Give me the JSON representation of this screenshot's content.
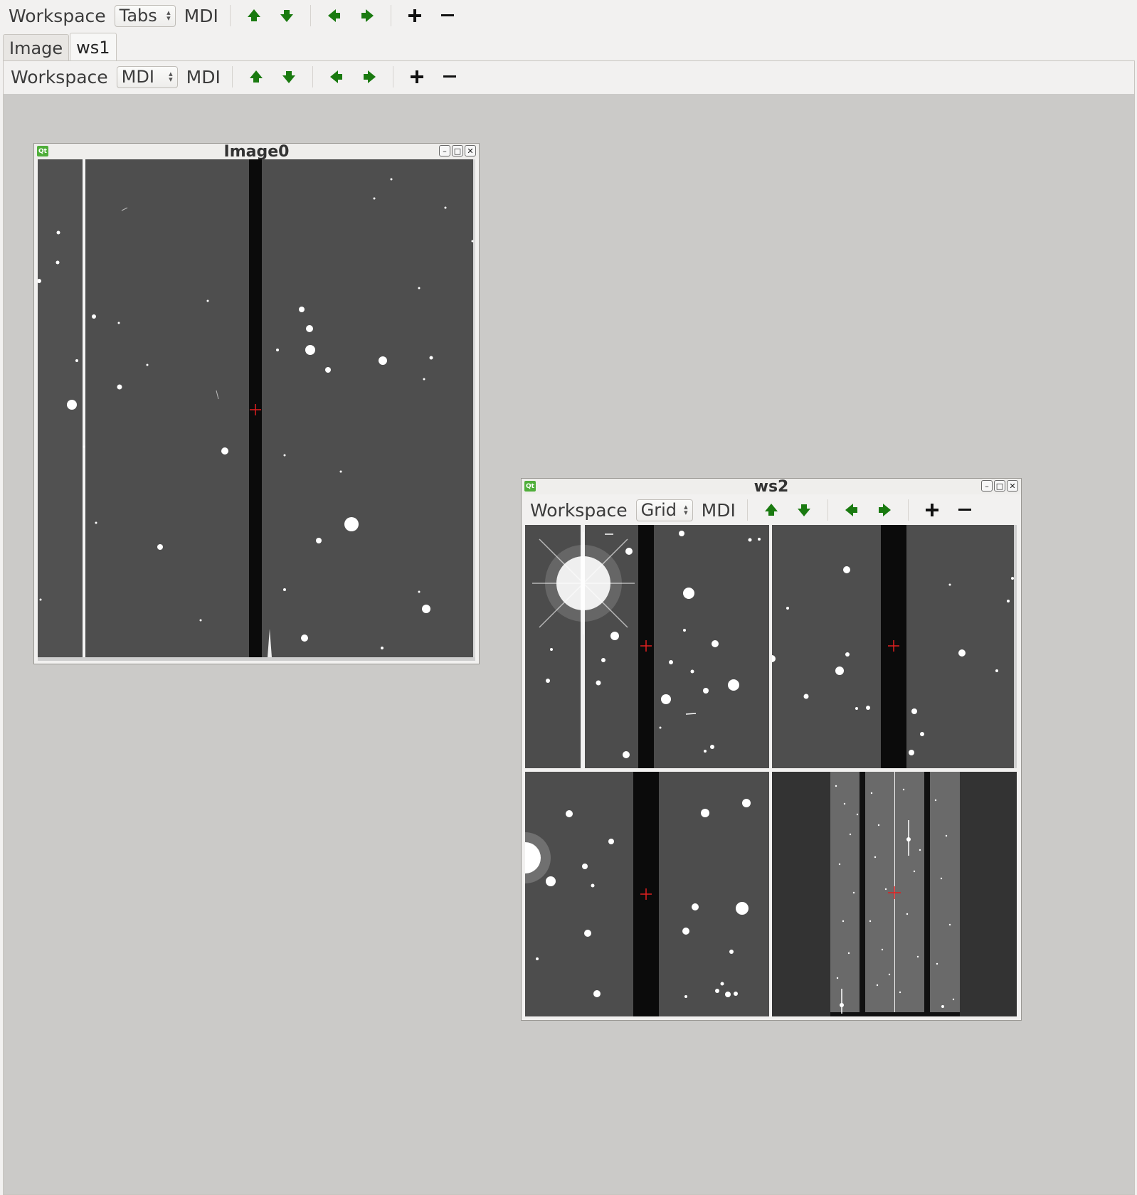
{
  "top_toolbar": {
    "workspace_label": "Workspace",
    "mode_combo_value": "Tabs",
    "mdi_label": "MDI"
  },
  "tabs": [
    {
      "label": "Image",
      "active": false
    },
    {
      "label": "ws1",
      "active": true
    }
  ],
  "ws1_toolbar": {
    "workspace_label": "Workspace",
    "mode_combo_value": "MDI",
    "mdi_label": "MDI"
  },
  "windows": {
    "image0": {
      "title": "Image0"
    },
    "ws2": {
      "title": "ws2",
      "toolbar": {
        "workspace_label": "Workspace",
        "mode_combo_value": "Grid",
        "mdi_label": "MDI"
      }
    }
  },
  "icons": {
    "up": "green-up-arrow-icon",
    "down": "green-down-arrow-icon",
    "left": "green-left-arrow-icon",
    "right": "green-right-arrow-icon",
    "add": "plus-icon",
    "remove": "minus-icon"
  },
  "colors": {
    "arrow_green": "#1a7a10",
    "mdi_background": "#cbcac8",
    "sky_background": "#4e4e4e",
    "crosshair": "#e02020"
  }
}
